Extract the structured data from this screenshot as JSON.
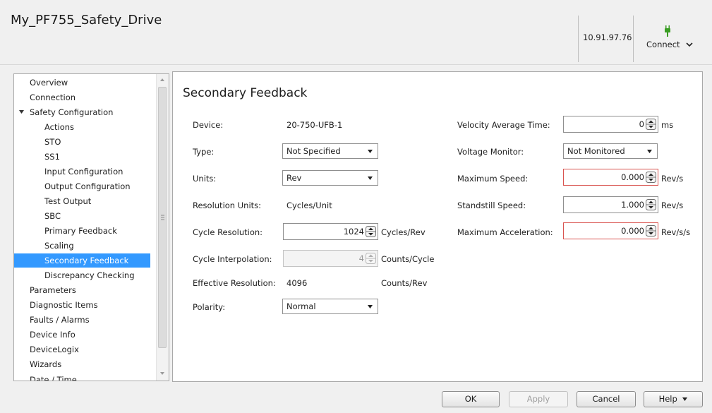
{
  "app": {
    "title": "My_PF755_Safety_Drive",
    "ip_address": "10.91.97.76",
    "connect_label": "Connect"
  },
  "nav": {
    "items": [
      {
        "label": "Overview",
        "level": 0
      },
      {
        "label": "Connection",
        "level": 0
      },
      {
        "label": "Safety Configuration",
        "level": 0,
        "expanded": true
      },
      {
        "label": "Actions",
        "level": 1
      },
      {
        "label": "STO",
        "level": 1
      },
      {
        "label": "SS1",
        "level": 1
      },
      {
        "label": "Input Configuration",
        "level": 1
      },
      {
        "label": "Output Configuration",
        "level": 1
      },
      {
        "label": "Test Output",
        "level": 1
      },
      {
        "label": "SBC",
        "level": 1
      },
      {
        "label": "Primary Feedback",
        "level": 1
      },
      {
        "label": "Scaling",
        "level": 1
      },
      {
        "label": "Secondary Feedback",
        "level": 1,
        "selected": true
      },
      {
        "label": "Discrepancy Checking",
        "level": 1
      },
      {
        "label": "Parameters",
        "level": 0
      },
      {
        "label": "Diagnostic Items",
        "level": 0
      },
      {
        "label": "Faults / Alarms",
        "level": 0
      },
      {
        "label": "Device Info",
        "level": 0
      },
      {
        "label": "DeviceLogix",
        "level": 0
      },
      {
        "label": "Wizards",
        "level": 0
      },
      {
        "label": "Date / Time",
        "level": 0
      }
    ]
  },
  "form": {
    "title": "Secondary Feedback",
    "device": {
      "label": "Device:",
      "value": "20-750-UFB-1"
    },
    "type": {
      "label": "Type:",
      "value": "Not Specified"
    },
    "units": {
      "label": "Units:",
      "value": "Rev"
    },
    "resolution_units": {
      "label": "Resolution Units:",
      "value": "Cycles/Unit"
    },
    "cycle_resolution": {
      "label": "Cycle Resolution:",
      "value": "1024",
      "unit": "Cycles/Rev"
    },
    "cycle_interpolation": {
      "label": "Cycle Interpolation:",
      "value": "4",
      "unit": "Counts/Cycle"
    },
    "effective_resolution": {
      "label": "Effective Resolution:",
      "value": "4096",
      "unit": "Counts/Rev"
    },
    "polarity": {
      "label": "Polarity:",
      "value": "Normal"
    },
    "velocity_average_time": {
      "label": "Velocity Average Time:",
      "value": "0",
      "unit": "ms"
    },
    "voltage_monitor": {
      "label": "Voltage Monitor:",
      "value": "Not Monitored"
    },
    "maximum_speed": {
      "label": "Maximum Speed:",
      "value": "0.000",
      "unit": "Rev/s"
    },
    "standstill_speed": {
      "label": "Standstill Speed:",
      "value": "1.000",
      "unit": "Rev/s"
    },
    "maximum_acceleration": {
      "label": "Maximum Acceleration:",
      "value": "0.000",
      "unit": "Rev/s/s"
    }
  },
  "buttons": {
    "ok": "OK",
    "apply": "Apply",
    "cancel": "Cancel",
    "help": "Help"
  },
  "colors": {
    "selection": "#3399ff",
    "error_border": "#d9534f",
    "connect_icon": "#3a9d23"
  }
}
